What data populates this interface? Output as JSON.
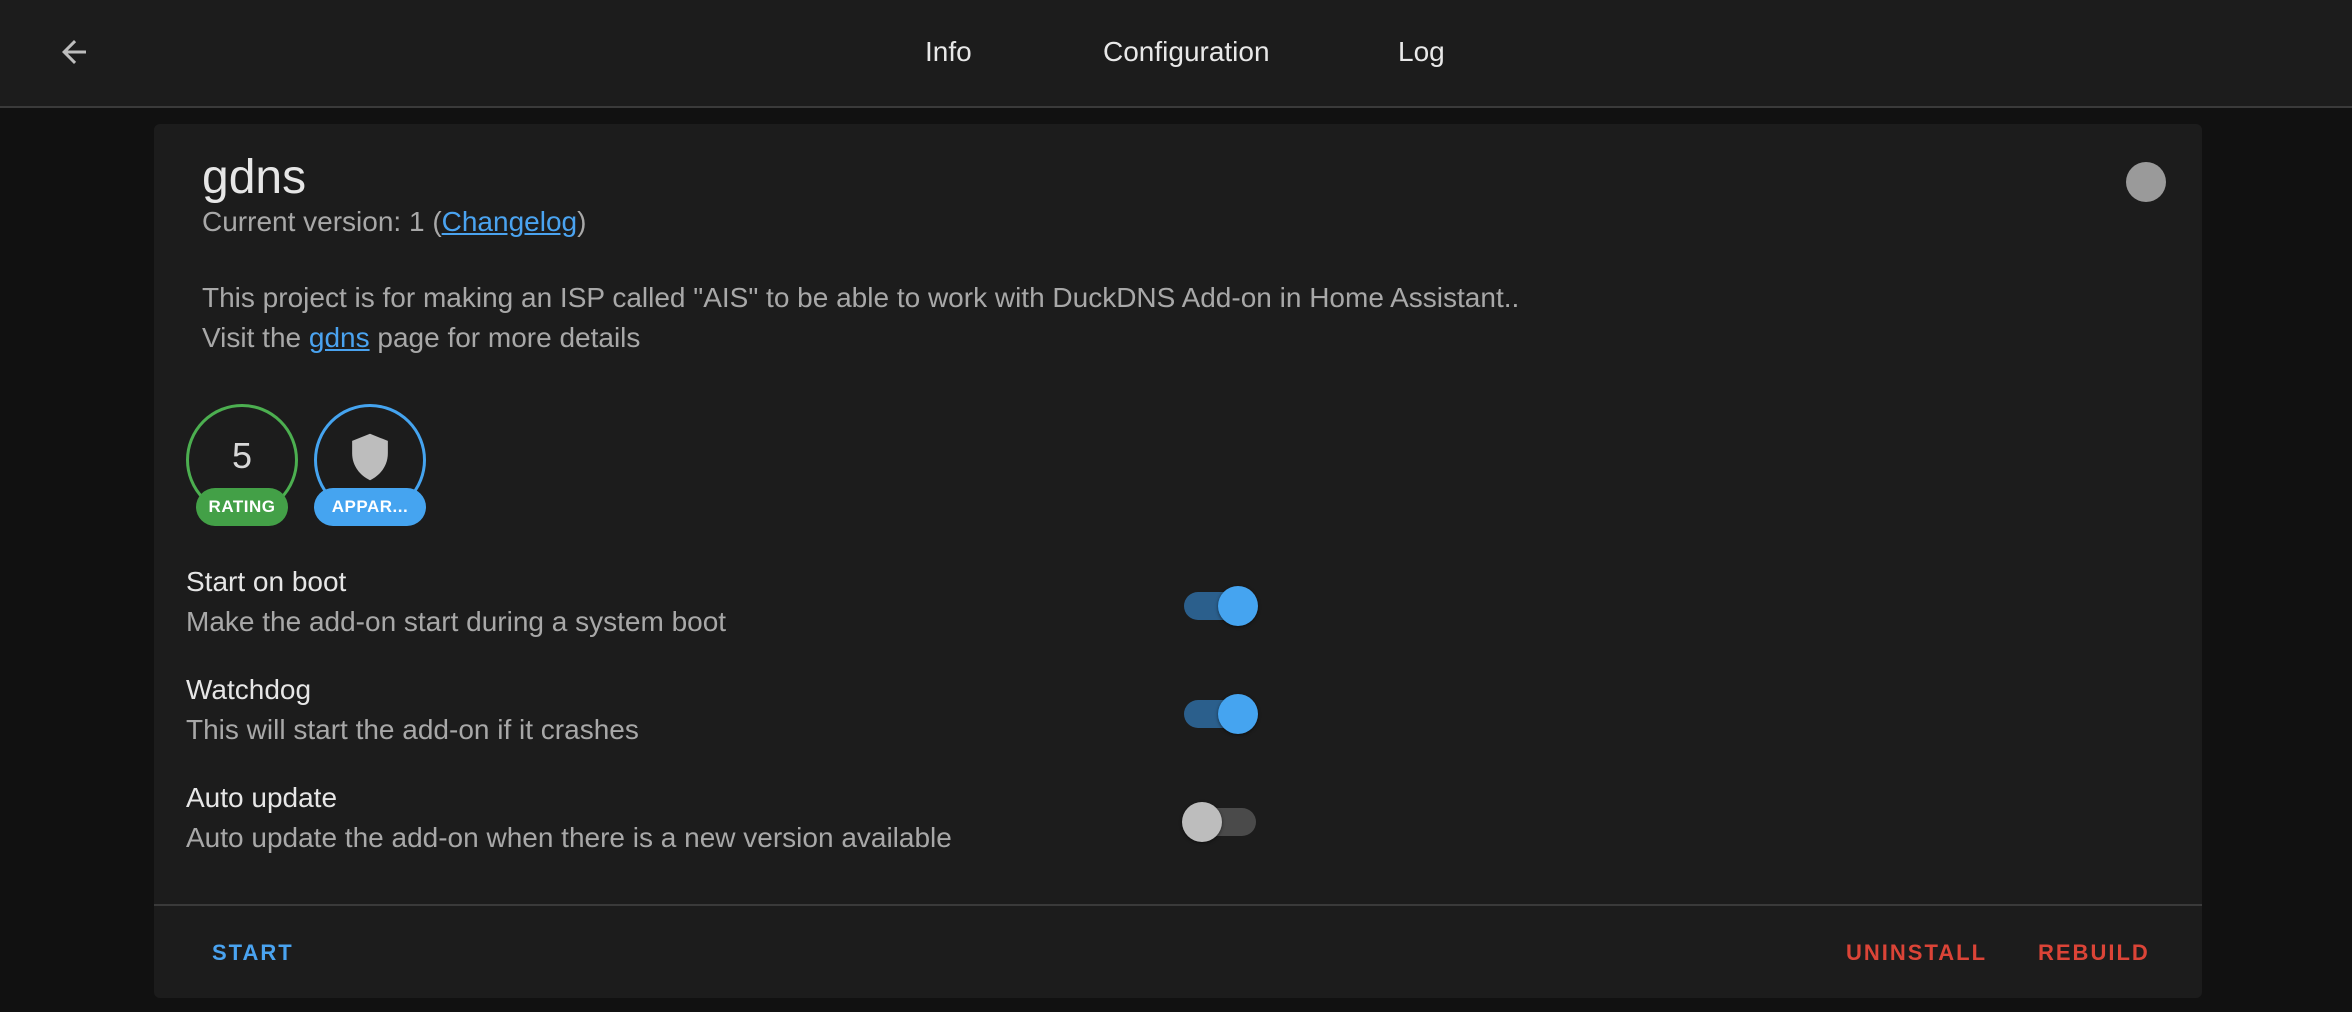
{
  "tabs": [
    "Info",
    "Configuration",
    "Log"
  ],
  "addon": {
    "name": "gdns",
    "version_prefix": "Current version: 1 (",
    "changelog_label": "Changelog",
    "version_suffix": ")",
    "description": "This project is for making an ISP called \"AIS\" to be able to work with DuckDNS Add-on in Home Assistant..",
    "visit_prefix": "Visit the ",
    "visit_link": "gdns",
    "visit_suffix": " page for more details"
  },
  "badges": {
    "rating": {
      "value": "5",
      "label": "RATING",
      "color": "#43a047"
    },
    "apparmor": {
      "label": "APPAR...",
      "icon": "shield-icon",
      "color": "#45a4f0"
    }
  },
  "settings": [
    {
      "title": "Start on boot",
      "subtitle": "Make the add-on start during a system boot",
      "enabled": true
    },
    {
      "title": "Watchdog",
      "subtitle": "This will start the add-on if it crashes",
      "enabled": true
    },
    {
      "title": "Auto update",
      "subtitle": "Auto update the add-on when there is a new version available",
      "enabled": false
    }
  ],
  "actions": {
    "start": "START",
    "uninstall": "UNINSTALL",
    "rebuild": "REBUILD"
  },
  "colors": {
    "accent": "#4aa3f0",
    "danger": "#db4437",
    "background": "#111111",
    "card": "#1c1c1c"
  }
}
